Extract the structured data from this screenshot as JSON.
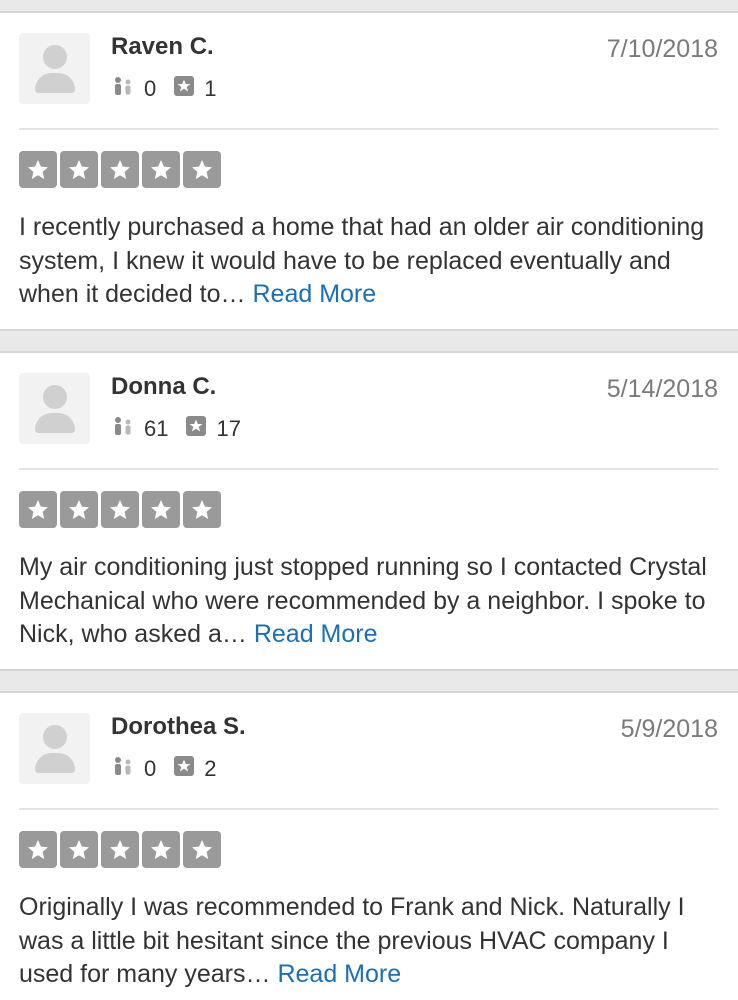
{
  "icons": {
    "friends": "friends-icon",
    "reviews": "review-count-icon",
    "star": "star-icon",
    "avatar": "default-avatar"
  },
  "colors": {
    "star_fill": "#9a9a9a",
    "link": "#1a6fb5",
    "text": "#333333",
    "date": "#7a7a7a"
  },
  "reviews": [
    {
      "name": "Raven C.",
      "date": "7/10/2018",
      "friends": "0",
      "review_count": "1",
      "rating": 5,
      "text": "I recently purchased a home that had an older air conditioning system, I knew it would have to be replaced eventually and when it decided to…",
      "read_more": "Read More"
    },
    {
      "name": "Donna C.",
      "date": "5/14/2018",
      "friends": "61",
      "review_count": "17",
      "rating": 5,
      "text": "My air conditioning just stopped running so I contacted Crystal Mechanical who were recommended by a neighbor. I spoke to Nick, who asked a…",
      "read_more": "Read More"
    },
    {
      "name": "Dorothea S.",
      "date": "5/9/2018",
      "friends": "0",
      "review_count": "2",
      "rating": 5,
      "text": "Originally I was recommended to Frank and Nick. Naturally I was a little bit hesitant since the previous HVAC company I used for many years…",
      "read_more": "Read More"
    }
  ]
}
